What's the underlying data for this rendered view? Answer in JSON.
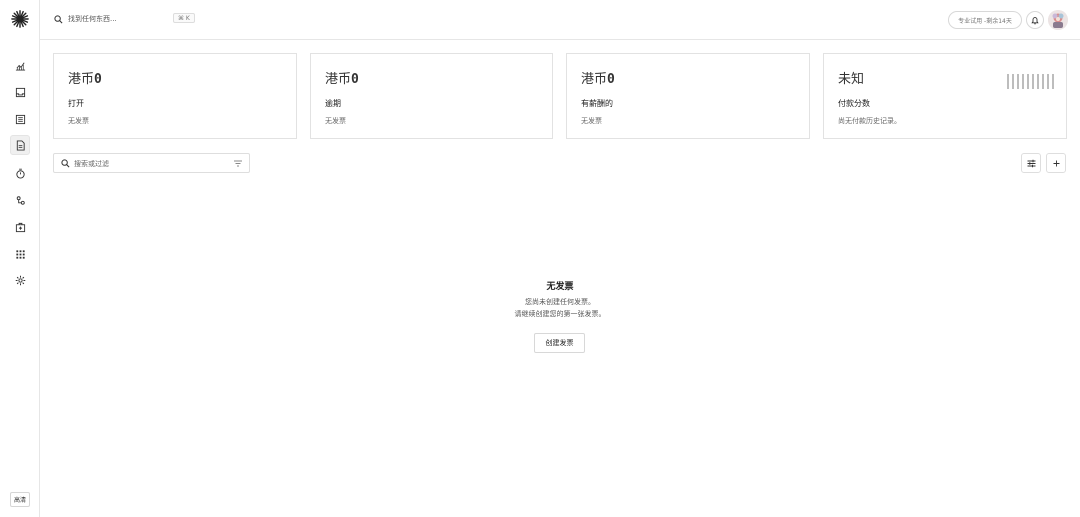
{
  "header": {
    "search_placeholder": "找到任何东西...",
    "shortcut": "⌘ K",
    "trial_badge": "专业试用 -剩余14天"
  },
  "sidebar": {
    "items": [
      {
        "icon": "chart-line-icon"
      },
      {
        "icon": "inbox-icon"
      },
      {
        "icon": "list-icon"
      },
      {
        "icon": "invoice-icon",
        "active": true
      },
      {
        "icon": "timer-icon"
      },
      {
        "icon": "workflow-icon"
      },
      {
        "icon": "vault-icon"
      },
      {
        "icon": "apps-grid-icon"
      },
      {
        "icon": "settings-icon"
      }
    ],
    "hd_label": "高清"
  },
  "cards": [
    {
      "currency": "港币",
      "value": "0",
      "label": "打开",
      "sub": "无发票"
    },
    {
      "currency": "港币",
      "value": "0",
      "label": "逾期",
      "sub": "无发票"
    },
    {
      "currency": "港币",
      "value": "0",
      "label": "有薪酬的",
      "sub": "无发票"
    },
    {
      "currency": "未知",
      "value": "",
      "label": "付款分数",
      "sub": "尚无付款历史记录。"
    }
  ],
  "filter": {
    "placeholder": "搜索或过滤"
  },
  "empty_state": {
    "title": "无发票",
    "line1": "您尚未创建任何发票。",
    "line2": "请继续创建您的第一张发票。",
    "button": "创建发票"
  },
  "colors": {
    "border": "#e2e2e2",
    "text": "#222222",
    "muted": "#666666"
  }
}
